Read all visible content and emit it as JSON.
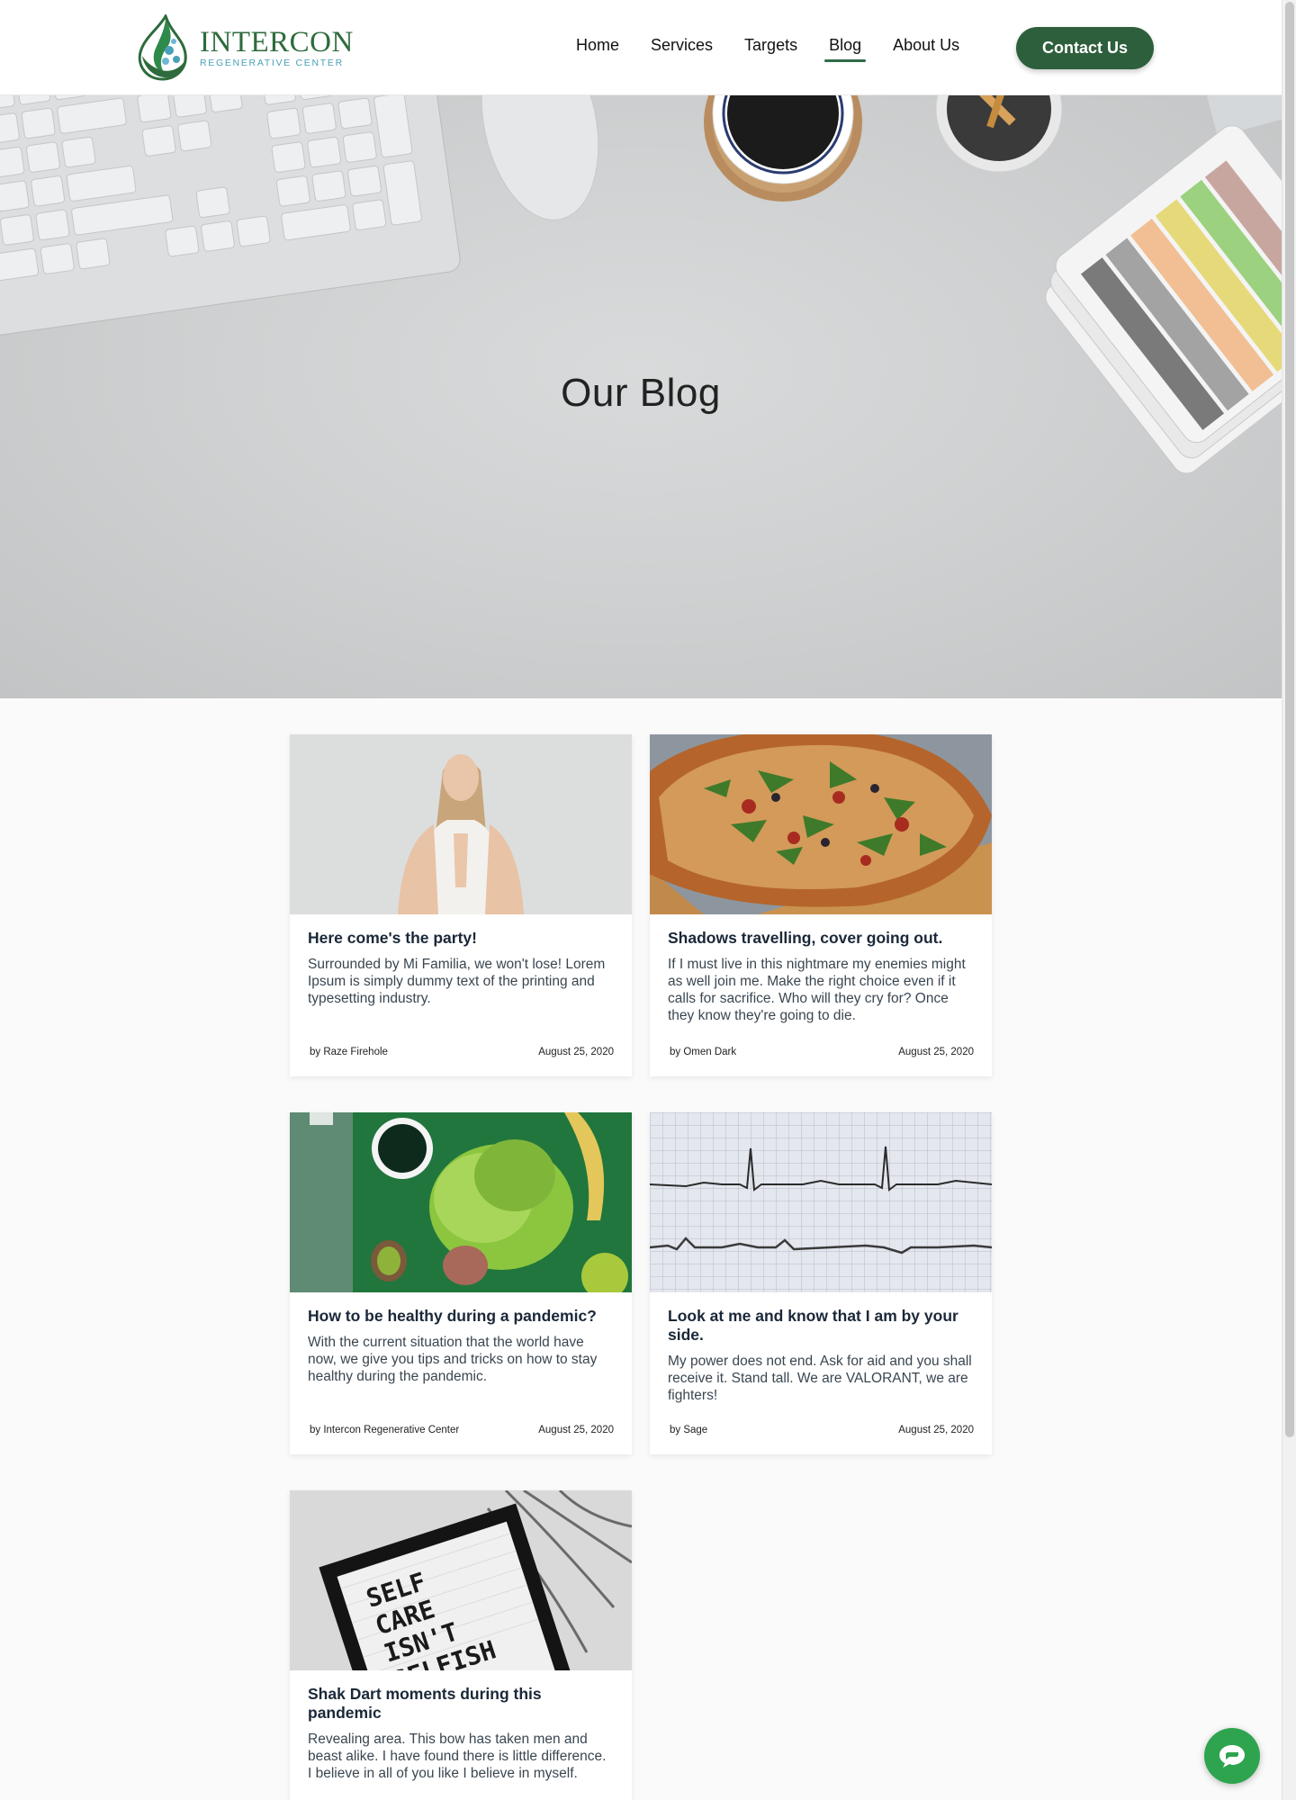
{
  "header": {
    "logo_name": "INTERCON",
    "logo_sub": "REGENERATIVE CENTER",
    "nav": [
      {
        "label": "Home"
      },
      {
        "label": "Services"
      },
      {
        "label": "Targets"
      },
      {
        "label": "Blog",
        "active": true
      },
      {
        "label": "About Us"
      }
    ],
    "contact_label": "Contact Us"
  },
  "hero": {
    "title": "Our Blog"
  },
  "posts": [
    {
      "title": "Here come's the party!",
      "excerpt": "Surrounded by Mi Familia, we won't lose! Lorem Ipsum is simply dummy text of the printing and typesetting industry.",
      "author": "by Raze Firehole",
      "date": "August 25, 2020",
      "image": "woman-meditating"
    },
    {
      "title": "Shadows travelling, cover going out.",
      "excerpt": "If I must live in this nightmare my enemies might as well join me. Make the right choice even if it calls for sacrifice. Who will they cry for? Once they know they're going to die.",
      "author": "by Omen Dark",
      "date": "August 25, 2020",
      "image": "pizza-arugula"
    },
    {
      "title": "How to be healthy during a pandemic?",
      "excerpt": "With the current situation that the world have now, we give you tips and tricks on how to stay healthy during the pandemic.",
      "author": "by Intercon Regenerative Center",
      "date": "August 25, 2020",
      "image": "healthy-food"
    },
    {
      "title": "Look at me and know that I am by your side.",
      "excerpt": "My power does not end. Ask for aid and you shall receive it. Stand tall. We are VALORANT, we are fighters!",
      "author": "by Sage",
      "date": "August 25, 2020",
      "image": "ecg-chart"
    },
    {
      "title": "Shak Dart moments during this pandemic",
      "excerpt": "Revealing area. This bow has taken men and beast alike. I have found there is little difference. I believe in all of you like I believe in myself.",
      "image": "self-care-sign",
      "sign_text": [
        "SELF",
        "CARE",
        "ISN'T",
        "SELFISH"
      ]
    }
  ],
  "colors": {
    "brand_green": "#2e5f3c",
    "accent_teal": "#4aa0b8",
    "chat_green": "#2ea44f"
  }
}
